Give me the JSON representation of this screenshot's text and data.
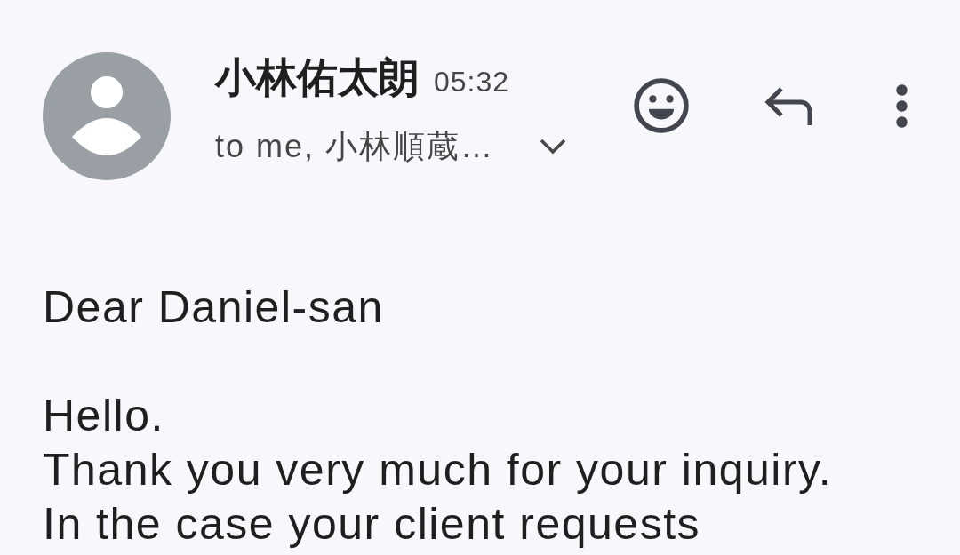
{
  "message": {
    "sender": "小林佑太朗",
    "time": "05:32",
    "recipients": {
      "text": "to me, 小林順蔵…",
      "expanded": false
    }
  },
  "actions": [
    {
      "kind": "emoji"
    },
    {
      "kind": "reply"
    },
    {
      "kind": "more"
    }
  ],
  "body": {
    "paragraphs": [
      [
        "Dear Daniel-san"
      ],
      [
        "Hello.",
        "Thank you very much for your inquiry.",
        "In the case your client requests"
      ]
    ]
  }
}
